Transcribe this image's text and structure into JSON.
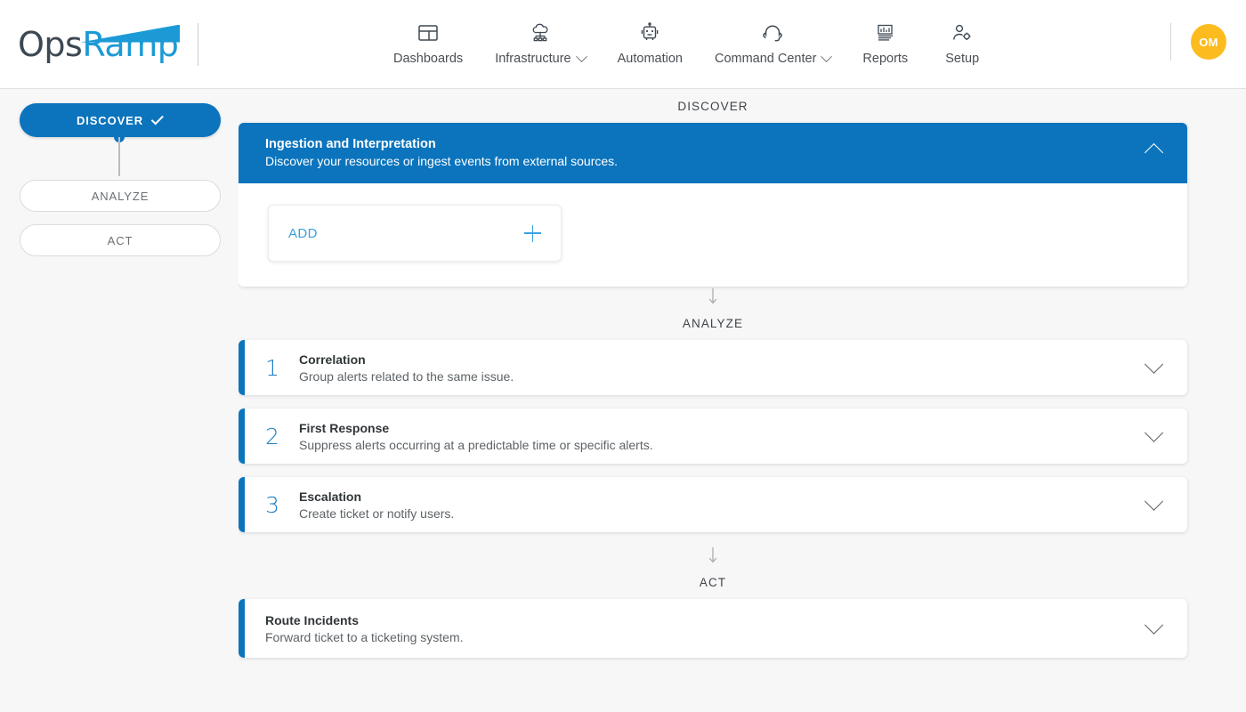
{
  "brand": {
    "name_part1": "Ops",
    "name_part2": "Ramp"
  },
  "nav": {
    "items": [
      {
        "label": "Dashboards",
        "icon": "dashboard-layout-icon",
        "has_caret": false
      },
      {
        "label": "Infrastructure",
        "icon": "cloud-network-icon",
        "has_caret": true
      },
      {
        "label": "Automation",
        "icon": "robot-icon",
        "has_caret": false
      },
      {
        "label": "Command Center",
        "icon": "headset-icon",
        "has_caret": true
      },
      {
        "label": "Reports",
        "icon": "report-chart-icon",
        "has_caret": false
      },
      {
        "label": "Setup",
        "icon": "user-gear-icon",
        "has_caret": false
      }
    ],
    "avatar_initials": "OM"
  },
  "sidebar": {
    "steps": [
      {
        "label": "DISCOVER",
        "state": "active",
        "icon": "check-icon"
      },
      {
        "label": "ANALYZE",
        "state": "idle"
      },
      {
        "label": "ACT",
        "state": "idle"
      }
    ]
  },
  "sections": {
    "discover": {
      "label": "DISCOVER",
      "panel": {
        "title": "Ingestion and Interpretation",
        "subtitle": "Discover your resources or ingest events from external sources.",
        "toggle_icon": "chevron-up-icon",
        "add_label": "ADD",
        "add_icon": "plus-icon"
      }
    },
    "analyze": {
      "label": "ANALYZE",
      "rows": [
        {
          "number": "1",
          "title": "Correlation",
          "subtitle": "Group alerts related to the same issue.",
          "toggle_icon": "chevron-down-icon"
        },
        {
          "number": "2",
          "title": "First Response",
          "subtitle": "Suppress alerts occurring at a predictable time or specific alerts.",
          "toggle_icon": "chevron-down-icon"
        },
        {
          "number": "3",
          "title": "Escalation",
          "subtitle": "Create ticket or notify users.",
          "toggle_icon": "chevron-down-icon"
        }
      ]
    },
    "act": {
      "label": "ACT",
      "rows": [
        {
          "number": "",
          "title": "Route Incidents",
          "subtitle": "Forward ticket to a ticketing system.",
          "toggle_icon": "chevron-down-icon"
        }
      ]
    }
  },
  "colors": {
    "brand_blue": "#0b74bd",
    "light_blue": "#3aa0e0",
    "avatar_yellow": "#fcbc1f",
    "page_bg": "#f7f7f8"
  }
}
